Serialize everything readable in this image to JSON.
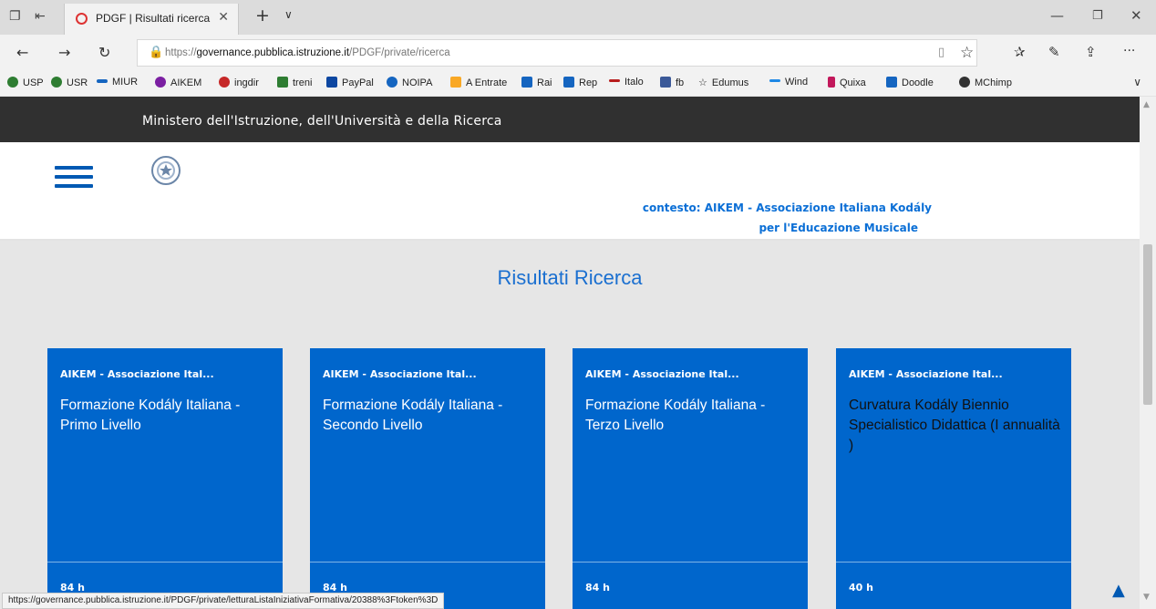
{
  "browser": {
    "tab_title": "PDGF | Risultati ricerca",
    "url_prefix": "https://",
    "url_domain": "governance.pubblica.istruzione.it",
    "url_path": "/PDGF/private/ricerca",
    "favorites": [
      {
        "label": "USP",
        "icon": "usp-icon",
        "color": "#2e7d32"
      },
      {
        "label": "USR",
        "icon": "usr-icon",
        "color": "#2e7d32"
      },
      {
        "label": "MIUR",
        "icon": "miur-icon",
        "color": "#1565c0"
      },
      {
        "label": "AIKEM",
        "icon": "music-note-icon",
        "color": "#7b1fa2"
      },
      {
        "label": "ingdir",
        "icon": "ingdir-icon",
        "color": "#c62828"
      },
      {
        "label": "treni",
        "icon": "treni-icon",
        "color": "#2e7d32"
      },
      {
        "label": "PayPal",
        "icon": "paypal-icon",
        "color": "#0d47a1"
      },
      {
        "label": "NOIPA",
        "icon": "noipa-icon",
        "color": "#1565c0"
      },
      {
        "label": "A Entrate",
        "icon": "entrate-icon",
        "color": "#f9a825"
      },
      {
        "label": "Rai",
        "icon": "rai-icon",
        "color": "#1565c0"
      },
      {
        "label": "Rep",
        "icon": "rep-icon",
        "color": "#1565c0"
      },
      {
        "label": "Italo",
        "icon": "italo-icon",
        "color": "#b71c1c"
      },
      {
        "label": "fb",
        "icon": "facebook-icon",
        "color": "#3b5998"
      },
      {
        "label": "Edumus",
        "icon": "star-icon",
        "color": "#555555"
      },
      {
        "label": "Wind",
        "icon": "wind-icon",
        "color": "#1e88e5"
      },
      {
        "label": "Quixa",
        "icon": "quixa-icon",
        "color": "#c2185b"
      },
      {
        "label": "Doodle",
        "icon": "doodle-icon",
        "color": "#1565c0"
      },
      {
        "label": "MChimp",
        "icon": "mailchimp-icon",
        "color": "#333333"
      }
    ],
    "status_url": "https://governance.pubblica.istruzione.it/PDGF/private/letturaListaIniziativaFormativa/20388%3Ftoken%3D"
  },
  "page": {
    "ministry": "Ministero dell'Istruzione, dell'Università e della Ricerca",
    "contesto_line1": "contesto: AIKEM - Associazione Italiana Kodály",
    "contesto_line2": "per l'Educazione Musicale",
    "title": "Risultati Ricerca",
    "cards": [
      {
        "org": "AIKEM - Associazione Ital...",
        "title": "Formazione Kodály Italiana - Primo Livello",
        "hours": "84 h"
      },
      {
        "org": "AIKEM - Associazione Ital...",
        "title": "Formazione Kodály Italiana - Secondo Livello",
        "hours": "84 h"
      },
      {
        "org": "AIKEM - Associazione Ital...",
        "title": "Formazione Kodály Italiana - Terzo Livello",
        "hours": "84 h"
      },
      {
        "org": "AIKEM - Associazione Ital...",
        "title": "Curvatura Kodály Biennio Specialistico Didattica (I annualità )",
        "hours": "40 h"
      }
    ]
  },
  "colors": {
    "accent": "#0066cc",
    "header_dark": "#303030",
    "link_blue": "#0b6fd6"
  }
}
